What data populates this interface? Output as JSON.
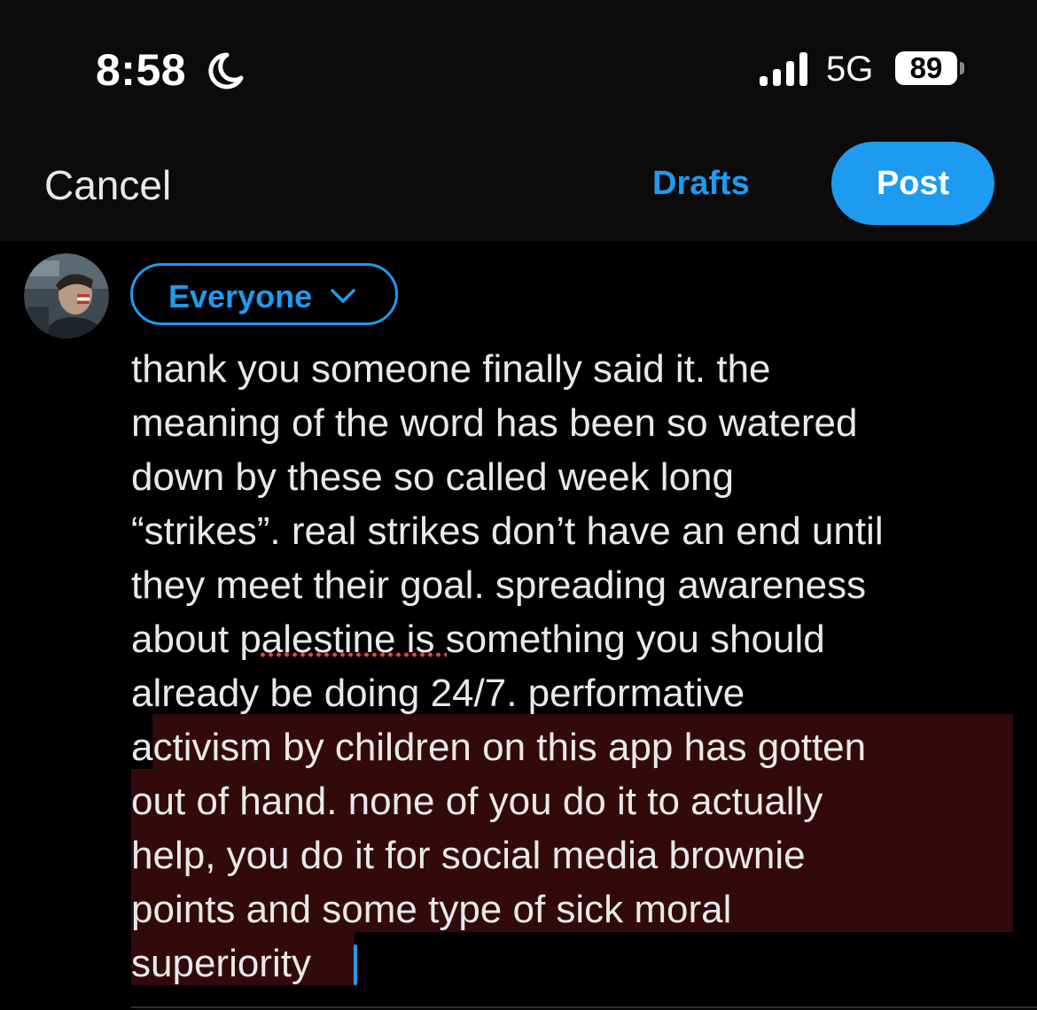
{
  "status_bar": {
    "time": "8:58",
    "network": "5G",
    "battery": "89"
  },
  "nav": {
    "cancel_label": "Cancel",
    "drafts_label": "Drafts",
    "post_label": "Post"
  },
  "composer": {
    "audience_label": "Everyone",
    "text": "thank you someone finally said it. the\nmeaning of the word has been so watered\ndown by these so called week long\n“strikes”. real strikes don’t have an end until\nthey meet their goal. spreading awareness\nabout palestine is something you should\nalready be doing 24/7. performative\nactivism by children on this app has gotten\nout of hand. none of you do it to actually\nhelp, you do it for social media brownie\npoints and some type of sick moral\nsuperiority"
  },
  "colors": {
    "accent": "#1d9bf0",
    "background": "#000000",
    "header_background": "#0b0b0b",
    "text": "#e7e9ea",
    "selection_highlight": "#330a0c",
    "spellcheck": "#e0443a"
  },
  "icons": {
    "moon": "moon-icon",
    "signal": "signal-icon",
    "chevron": "chevron-down-icon"
  }
}
